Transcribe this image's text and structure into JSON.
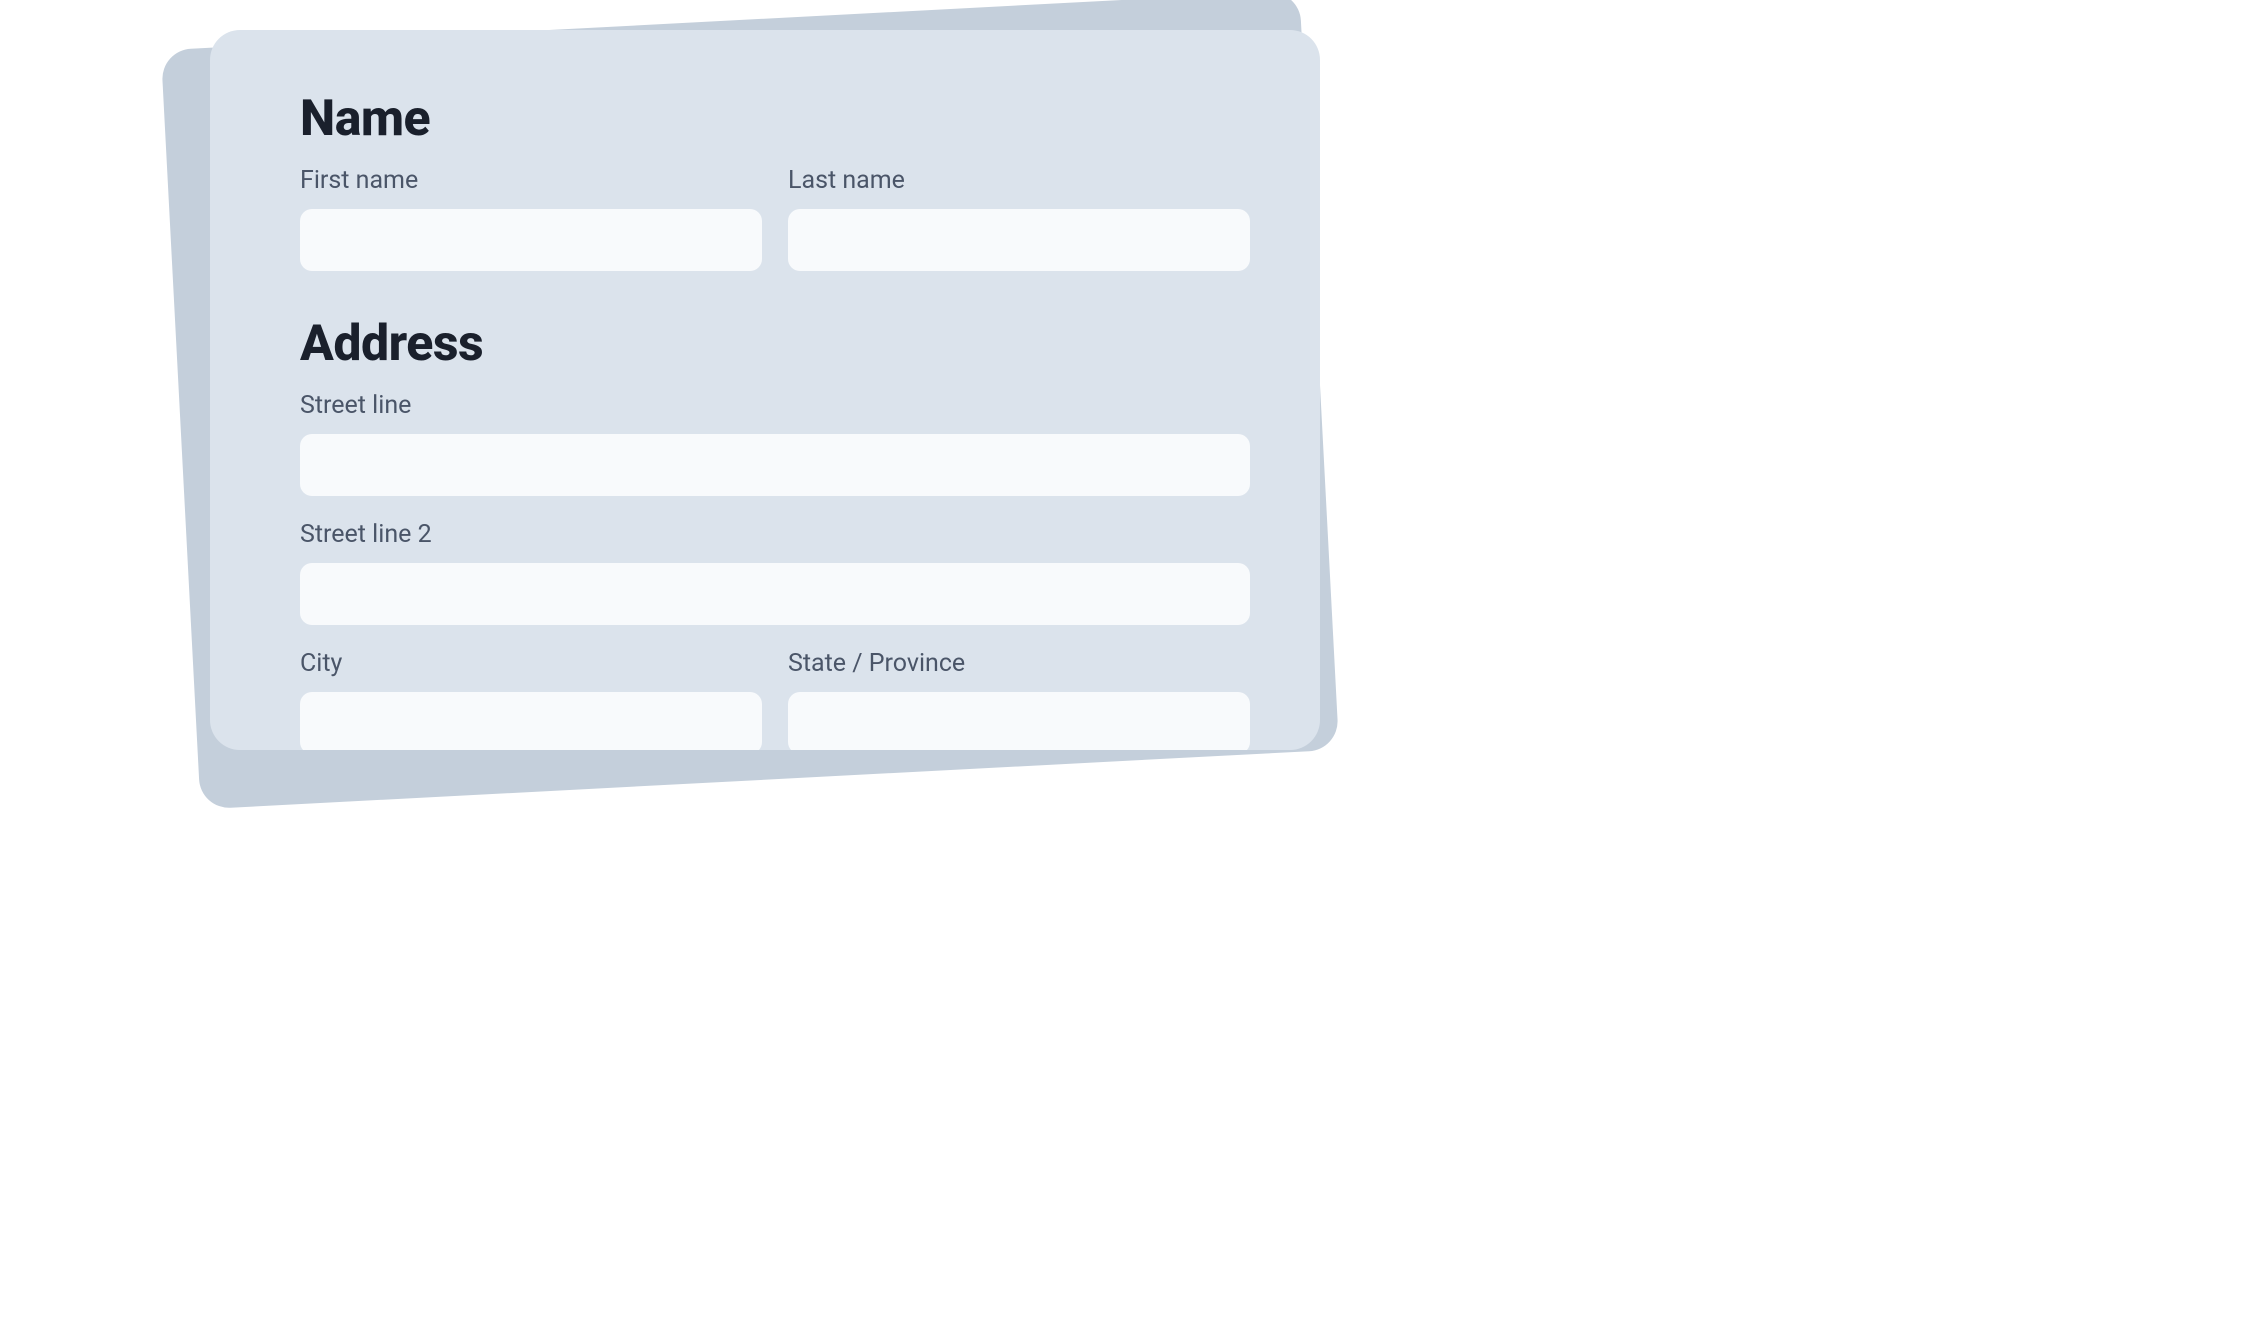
{
  "sections": {
    "name": {
      "heading": "Name",
      "first_name_label": "First name",
      "first_name_value": "",
      "last_name_label": "Last name",
      "last_name_value": ""
    },
    "address": {
      "heading": "Address",
      "street_line_label": "Street line",
      "street_line_value": "",
      "street_line_2_label": "Street line 2",
      "street_line_2_value": "",
      "city_label": "City",
      "city_value": "",
      "state_label": "State / Province",
      "state_value": ""
    }
  }
}
